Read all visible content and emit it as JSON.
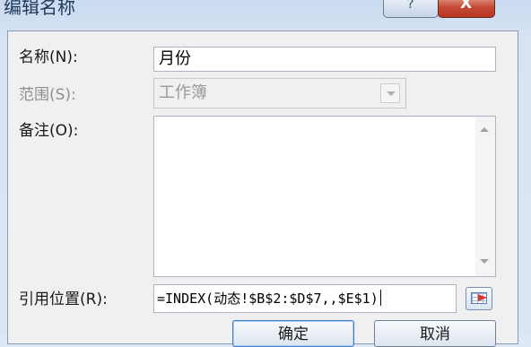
{
  "window": {
    "title": "编辑名称",
    "help_glyph": "?",
    "close_glyph": "X"
  },
  "form": {
    "name_label": "名称(N):",
    "name_value": "月份",
    "scope_label": "范围(S):",
    "scope_value": "工作簿",
    "comment_label": "备注(O):",
    "comment_value": "",
    "refers_label": "引用位置(R):",
    "refers_value": "=INDEX(动态!$B$2:$D$7,,$E$1)"
  },
  "buttons": {
    "ok": "确定",
    "cancel": "取消"
  },
  "colors": {
    "title_text": "#1e395b",
    "close_button": "#c54a33",
    "dialog_background": "#f0f0f0"
  }
}
